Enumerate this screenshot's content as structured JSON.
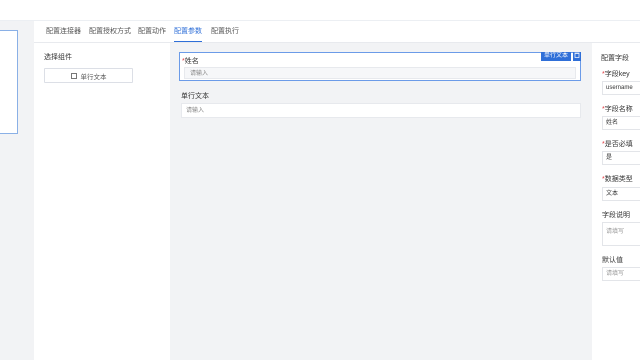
{
  "tabs": [
    {
      "label": "配置连接器"
    },
    {
      "label": "配置授权方式"
    },
    {
      "label": "配置动作"
    },
    {
      "label": "配置参数",
      "active": true
    },
    {
      "label": "配置执行"
    }
  ],
  "components": {
    "title": "选择组件",
    "items": [
      {
        "label": "单行文本",
        "icon": "text-box-icon"
      }
    ]
  },
  "canvas": {
    "selected_field": {
      "required_mark": "*",
      "label": "姓名",
      "placeholder": "请输入",
      "type_tag": "单行文本",
      "delete_icon": "delete-icon"
    },
    "field2": {
      "label": "单行文本",
      "placeholder": "请输入"
    }
  },
  "config": {
    "title": "配置字段",
    "field_key": {
      "required_mark": "*",
      "label": "字段key",
      "value": "username"
    },
    "field_name": {
      "required_mark": "*",
      "label": "字段名称",
      "value": "姓名"
    },
    "required": {
      "required_mark": "*",
      "label": "是否必填",
      "value": "是"
    },
    "data_type": {
      "required_mark": "*",
      "label": "数据类型",
      "value": "文本"
    },
    "description": {
      "label": "字段说明",
      "placeholder": "请填写"
    },
    "default_value": {
      "label": "默认值",
      "placeholder": "请填写"
    }
  },
  "colors": {
    "accent": "#2f6fd8",
    "required": "#e0393e",
    "canvas_bg": "#f2f3f5"
  }
}
